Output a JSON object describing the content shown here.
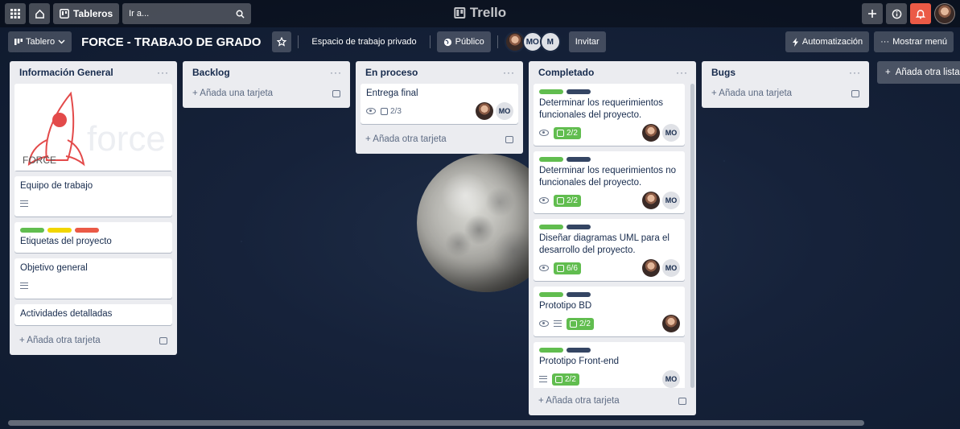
{
  "topbar": {
    "boards_label": "Tableros",
    "search_placeholder": "Ir a...",
    "logo_text": "Trello"
  },
  "boardbar": {
    "view_label": "Tablero",
    "title": "FORCE - TRABAJO DE GRADO",
    "workspace": "Espacio de trabajo privado",
    "visibility": "Público",
    "members": [
      "MO",
      "M"
    ],
    "invite": "Invitar",
    "automation": "Automatización",
    "menu": "Mostrar menú"
  },
  "lists": {
    "info": {
      "title": "Información General",
      "cover_text": "FORCE",
      "cover_watermark": "force",
      "cards": [
        {
          "title": "Equipo de trabajo"
        },
        {
          "title": "Etiquetas del proyecto"
        },
        {
          "title": "Objetivo general"
        },
        {
          "title": "Actividades detalladas"
        }
      ],
      "add": "Añada otra tarjeta"
    },
    "backlog": {
      "title": "Backlog",
      "add": "Añada una tarjeta"
    },
    "inprogress": {
      "title": "En proceso",
      "cards": [
        {
          "title": "Entrega final",
          "checklist": "2/3",
          "member": "MO"
        }
      ],
      "add": "Añada otra tarjeta"
    },
    "done": {
      "title": "Completado",
      "cards": [
        {
          "title": "Determinar los requerimientos funcionales del proyecto.",
          "checklist": "2/2",
          "member": "MO"
        },
        {
          "title": "Determinar los requerimientos no funcionales del proyecto.",
          "checklist": "2/2",
          "member": "MO"
        },
        {
          "title": "Diseñar diagramas UML para el desarrollo del proyecto.",
          "checklist": "6/6",
          "member": "MO"
        },
        {
          "title": "Prototipo BD",
          "checklist": "2/2"
        },
        {
          "title": "Prototipo Front-end",
          "checklist": "2/2",
          "member": "MO"
        }
      ],
      "add": "Añada otra tarjeta"
    },
    "bugs": {
      "title": "Bugs",
      "add": "Añada una tarjeta"
    }
  },
  "add_list": "Añada otra lista",
  "colors": {
    "label_green": "#61bd4f",
    "label_yellow": "#f2d600",
    "label_red": "#eb5a46",
    "label_navy": "#344563",
    "notify": "#eb5a46"
  }
}
